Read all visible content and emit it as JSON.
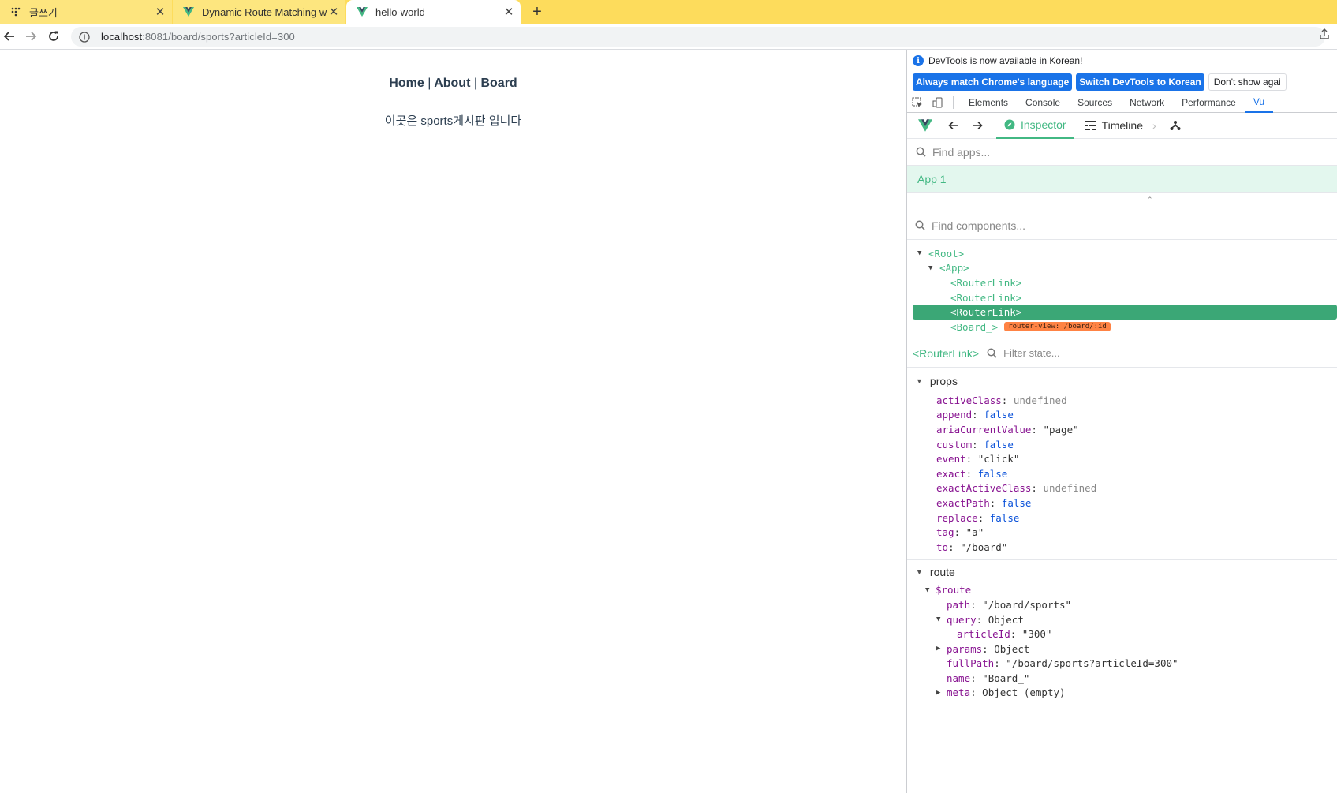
{
  "browser": {
    "tabs": [
      {
        "title": "글쓰기",
        "icon": "app-grid-icon",
        "active": false
      },
      {
        "title": "Dynamic Route Matching with P",
        "icon": "vue-logo-icon",
        "active": false
      },
      {
        "title": "hello-world",
        "icon": "vue-logo-icon",
        "active": true
      }
    ],
    "url_host": "localhost",
    "url_rest": ":8081/board/sports?articleId=300"
  },
  "page": {
    "nav": {
      "home": "Home",
      "about": "About",
      "board": "Board",
      "separator": "|"
    },
    "board_text": "이곳은 sports게시판 입니다"
  },
  "devtools": {
    "info_message": "DevTools is now available in Korean!",
    "btn_match_language": "Always match Chrome's language",
    "btn_switch_korean": "Switch DevTools to Korean",
    "btn_dont_show": "Don't show agai",
    "panel_tabs": [
      "Elements",
      "Console",
      "Sources",
      "Network",
      "Performance",
      "Vu"
    ],
    "active_panel": "Vu",
    "vue": {
      "tab_inspector": "Inspector",
      "tab_timeline": "Timeline",
      "find_apps_placeholder": "Find apps...",
      "app_name": "App 1",
      "find_components_placeholder": "Find components...",
      "tree": [
        {
          "label": "<Root>",
          "expanded": true,
          "indent": 0
        },
        {
          "label": "<App>",
          "expanded": true,
          "indent": 1
        },
        {
          "label": "<RouterLink>",
          "indent": 2
        },
        {
          "label": "<RouterLink>",
          "indent": 2
        },
        {
          "label": "<RouterLink>",
          "indent": 2,
          "selected": true
        },
        {
          "label": "<Board_>",
          "indent": 2,
          "badge": "router-view: /board/:id"
        }
      ],
      "selected_component": "<RouterLink>",
      "filter_state_placeholder": "Filter state...",
      "props_title": "props",
      "props": [
        {
          "key": "activeClass",
          "value": "undefined",
          "kind": "undef"
        },
        {
          "key": "append",
          "value": "false",
          "kind": "bool"
        },
        {
          "key": "ariaCurrentValue",
          "value": "\"page\"",
          "kind": "str"
        },
        {
          "key": "custom",
          "value": "false",
          "kind": "bool"
        },
        {
          "key": "event",
          "value": "\"click\"",
          "kind": "str"
        },
        {
          "key": "exact",
          "value": "false",
          "kind": "bool"
        },
        {
          "key": "exactActiveClass",
          "value": "undefined",
          "kind": "undef"
        },
        {
          "key": "exactPath",
          "value": "false",
          "kind": "bool"
        },
        {
          "key": "replace",
          "value": "false",
          "kind": "bool"
        },
        {
          "key": "tag",
          "value": "\"a\"",
          "kind": "str"
        },
        {
          "key": "to",
          "value": "\"/board\"",
          "kind": "str"
        }
      ],
      "route_title": "route",
      "route_root": "$route",
      "route": {
        "path": {
          "key": "path",
          "value": "\"/board/sports\""
        },
        "query": {
          "key": "query",
          "value": "Object"
        },
        "articleId": {
          "key": "articleId",
          "value": "\"300\""
        },
        "params": {
          "key": "params",
          "value": "Object"
        },
        "fullPath": {
          "key": "fullPath",
          "value": "\"/board/sports?articleId=300\""
        },
        "name": {
          "key": "name",
          "value": "\"Board_\""
        },
        "meta": {
          "key": "meta",
          "value": "Object (empty)"
        }
      }
    }
  },
  "colors": {
    "tabbar": "#fddc5c",
    "vue_green": "#42b883",
    "selected_row": "#3ba776",
    "badge_orange": "#ff8344",
    "chrome_blue": "#1a73e8"
  }
}
